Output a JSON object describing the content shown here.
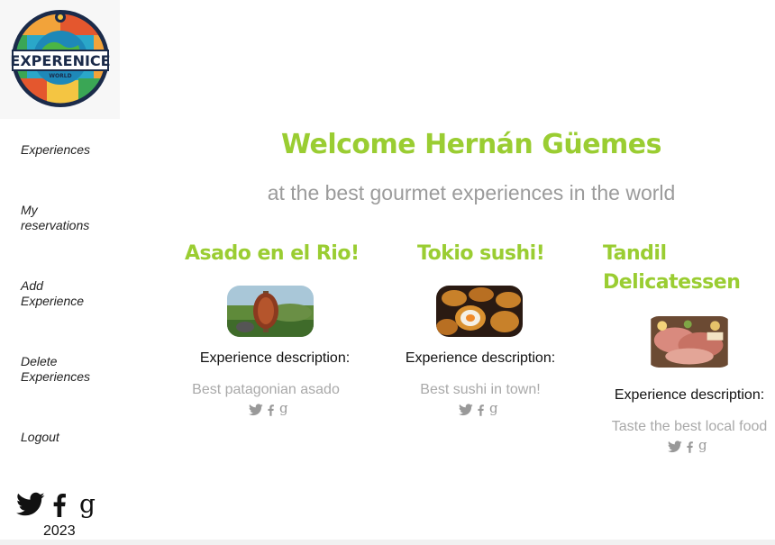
{
  "sidebar": {
    "logo_text": "EXPERENICE",
    "logo_subtext": "WORLD",
    "nav": [
      {
        "label": "Experiences"
      },
      {
        "label": "My reservations"
      },
      {
        "label": "Add Experience"
      },
      {
        "label": "Delete Experiences"
      },
      {
        "label": "Logout"
      }
    ],
    "year": "2023"
  },
  "header": {
    "welcome": "Welcome Hernán Güemes",
    "subtitle": "at the best gourmet experiences in the world"
  },
  "cards": [
    {
      "title": "Asado en el Rio!",
      "label": "Experience description:",
      "description": "Best patagonian asado"
    },
    {
      "title": "Tokio sushi!",
      "label": "Experience description:",
      "description": "Best sushi in town!"
    },
    {
      "title": "Tandil Delicatessen",
      "label": "Experience description:",
      "description": "Taste the best local food"
    }
  ],
  "colors": {
    "accent": "#9acd32",
    "muted": "#9b9b9b",
    "desc": "#a9a9a9"
  },
  "icons": [
    "twitter-icon",
    "facebook-icon",
    "google-icon"
  ]
}
